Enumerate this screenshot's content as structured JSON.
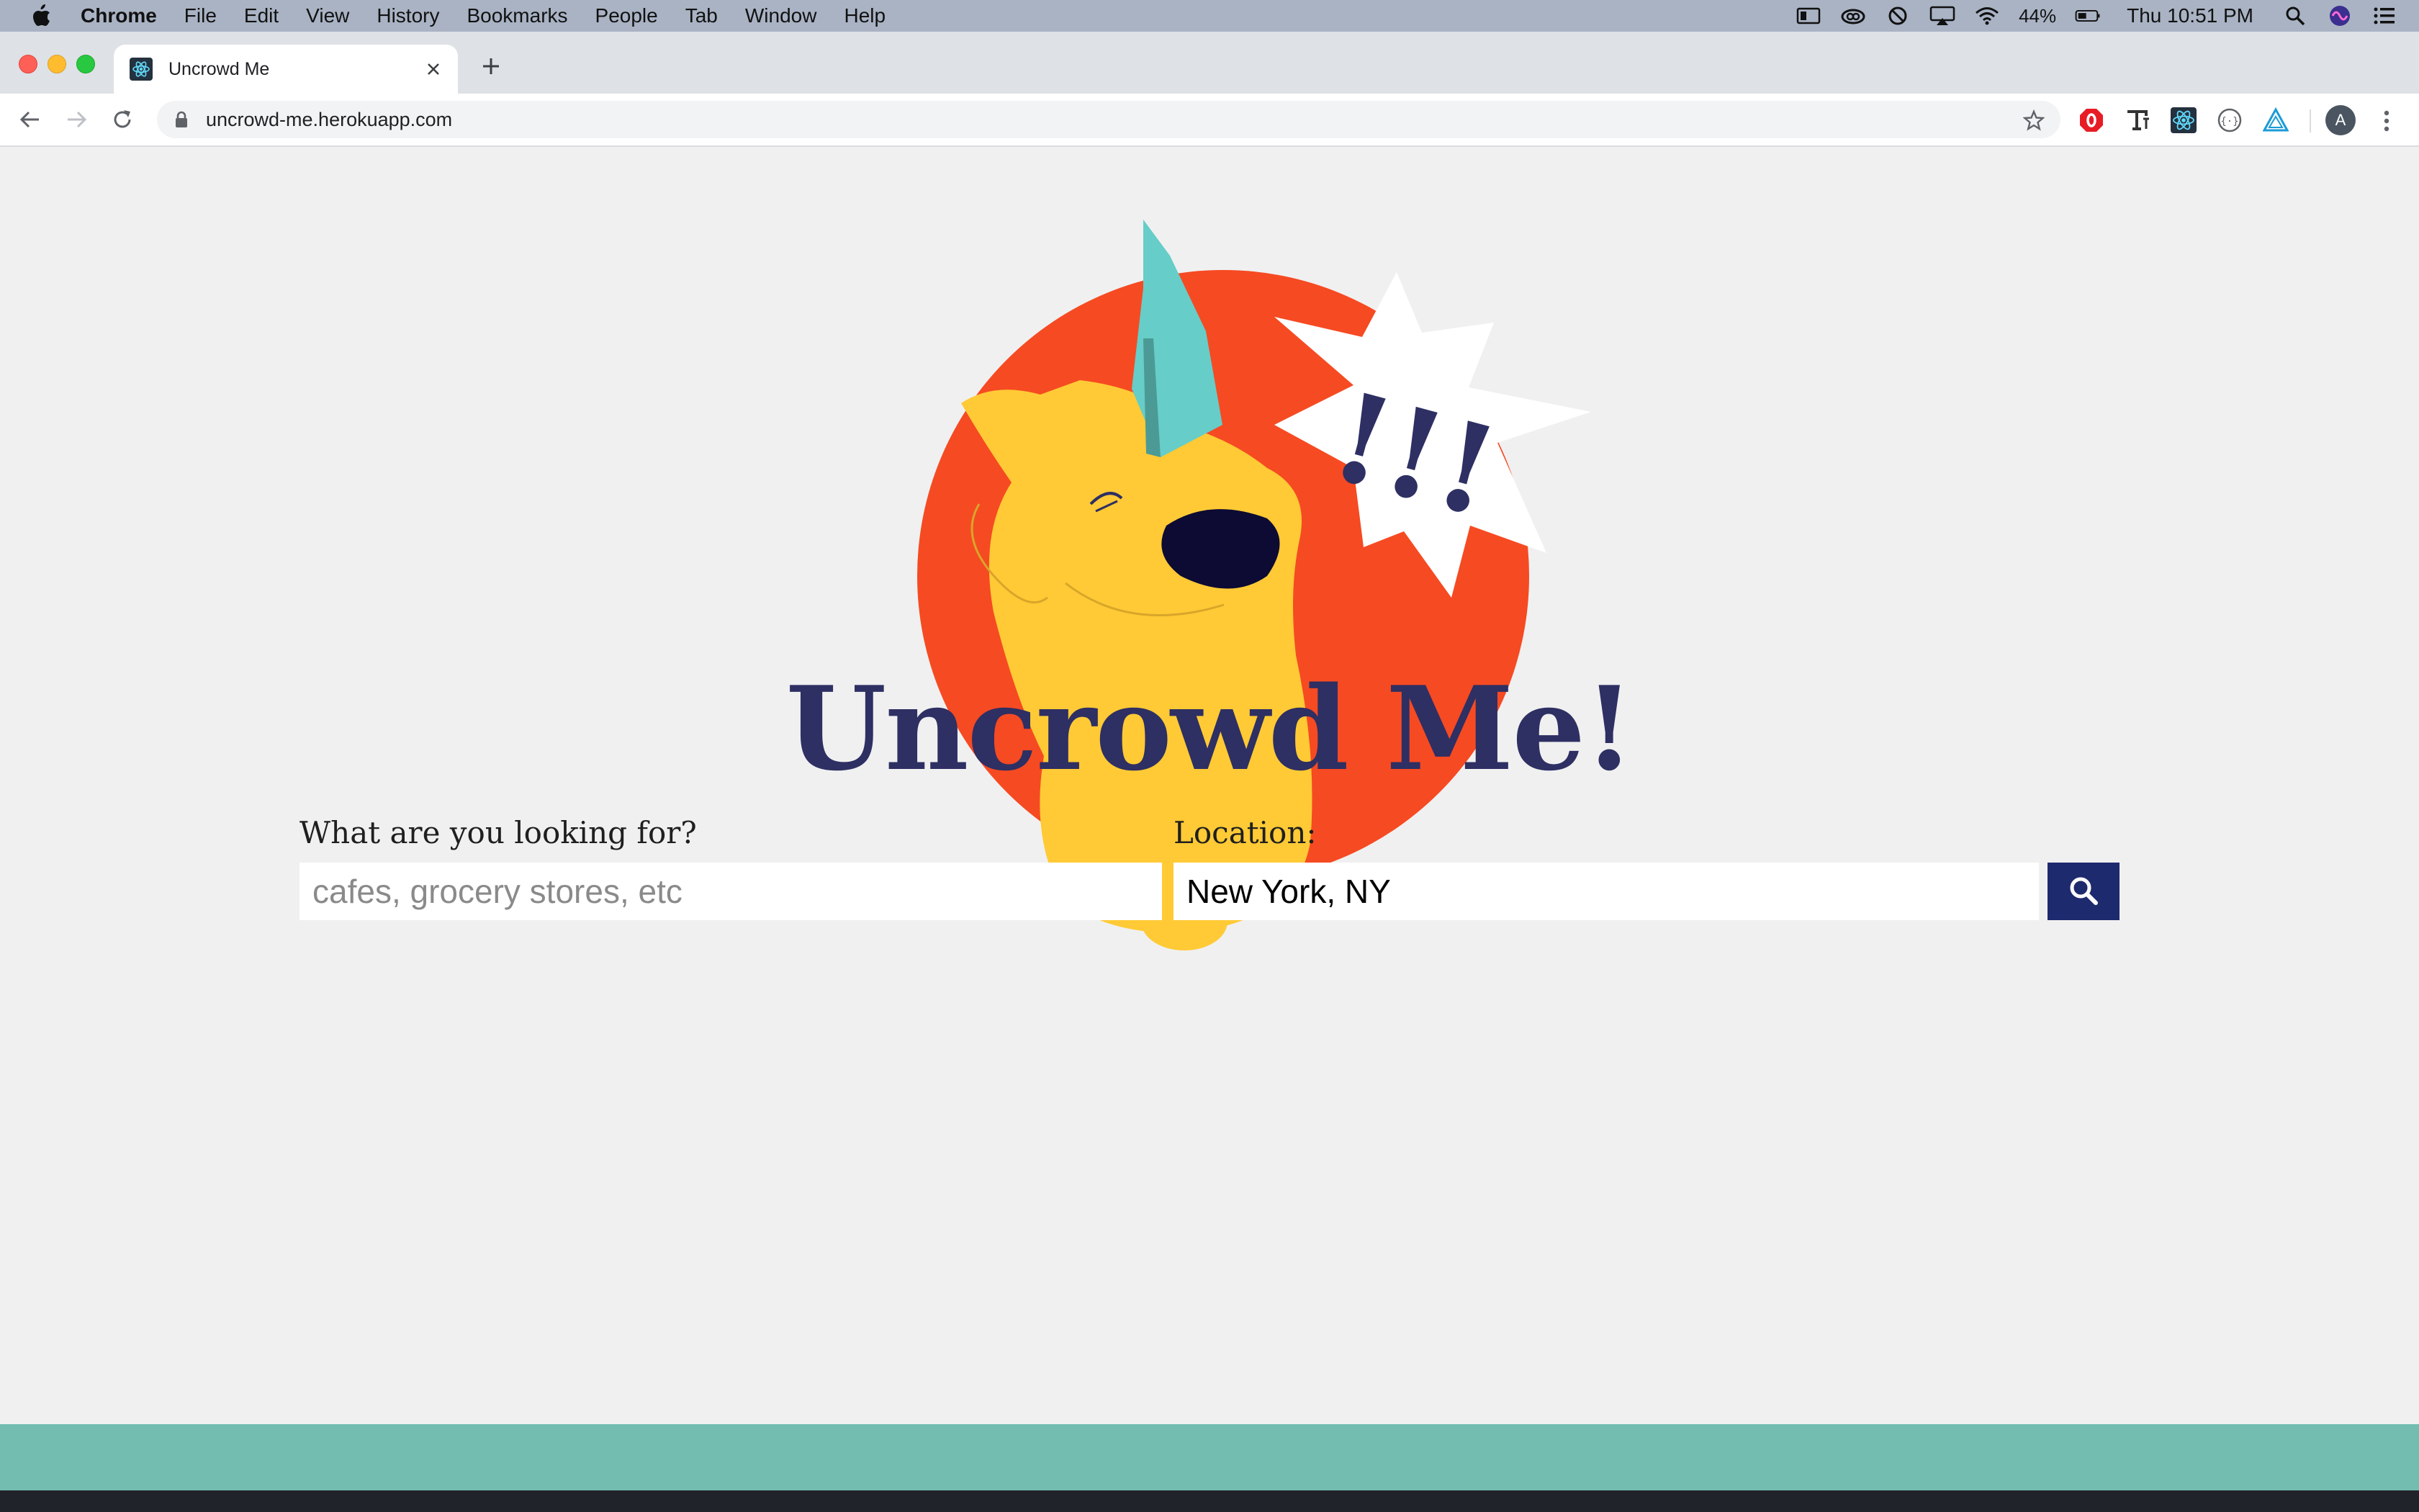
{
  "menubar": {
    "app_name": "Chrome",
    "items": [
      "File",
      "Edit",
      "View",
      "History",
      "Bookmarks",
      "People",
      "Tab",
      "Window",
      "Help"
    ],
    "battery": "44%",
    "clock": "Thu 10:51 PM"
  },
  "browser": {
    "tab_title": "Uncrowd Me",
    "url": "uncrowd-me.herokuapp.com",
    "profile_initial": "A"
  },
  "page": {
    "title": "Uncrowd Me!",
    "hero_exclamation": "!!!",
    "search": {
      "label": "What are you looking for?",
      "placeholder": "cafes, grocery stores, etc",
      "value": ""
    },
    "location": {
      "label": "Location:",
      "value": "New York, NY"
    }
  },
  "colors": {
    "title": "#2e2f63",
    "search_button": "#1e2a6e",
    "circle": "#f64a22",
    "mascot": "#ffca35",
    "hat": "#66cdc8",
    "footer": "#73bcb0",
    "page_bg": "#f0f0f0"
  }
}
